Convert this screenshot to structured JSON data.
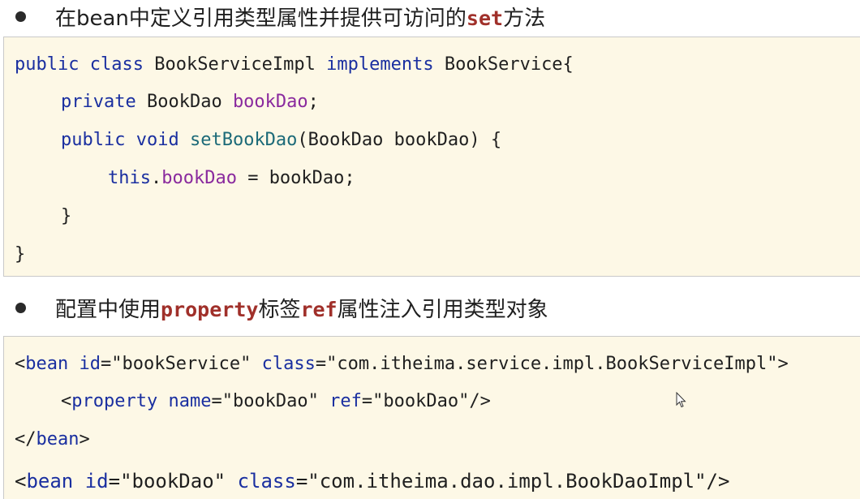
{
  "bullet1": {
    "prefix": "在bean中定义引用类型属性并提供可访问的",
    "keyword": "set",
    "suffix": "方法"
  },
  "code1": {
    "line1": {
      "kw1": "public",
      "kw2": "class",
      "name": "BookServiceImpl",
      "kw3": "implements",
      "iface": "BookService{"
    },
    "line2": {
      "kw": "private",
      "type": "BookDao",
      "field": "bookDao",
      "end": ";"
    },
    "line3": {
      "kw1": "public",
      "kw2": "void",
      "method": "setBookDao",
      "params": "(BookDao bookDao) {"
    },
    "line4": {
      "kw": "this",
      "dot": ".",
      "field": "bookDao",
      "rest": " = bookDao;"
    },
    "line5": "}",
    "line6": "}"
  },
  "bullet2": {
    "prefix": "配置中使用",
    "keyword1": "property",
    "middle": "标签",
    "keyword2": "ref",
    "suffix": "属性注入引用类型对象"
  },
  "code2": {
    "line1": {
      "open": "<",
      "tag": "bean",
      "attr1": "id",
      "eq1": "=",
      "val1": "\"bookService\"",
      "attr2": "class",
      "eq2": "=",
      "val2": "\"com.itheima.service.impl.BookServiceImpl\"",
      "close": ">"
    },
    "line2": {
      "open": "<",
      "tag": "property",
      "attr1": "name",
      "eq1": "=",
      "val1": "\"bookDao\"",
      "attr2": "ref",
      "eq2": "=",
      "val2": "\"bookDao\"",
      "close": "/>"
    },
    "line3": {
      "open": "</",
      "tag": "bean",
      "close": ">"
    },
    "line4": {
      "open": "<",
      "tag": "bean",
      "attr1": "id",
      "eq1": "=",
      "val1": "\"bookDao\"",
      "attr2": "class",
      "eq2": "=",
      "val2": "\"com.itheima.dao.impl.BookDaoImpl\"",
      "close": "/>"
    }
  },
  "colors": {
    "keyword_inline": "#a0302a",
    "code_keyword": "#1a2fa0",
    "code_field": "#8a2a9e",
    "code_method": "#1c6a78",
    "code_background": "#fdf8e6"
  },
  "icons": {
    "cursor": "mouse-pointer-icon"
  }
}
